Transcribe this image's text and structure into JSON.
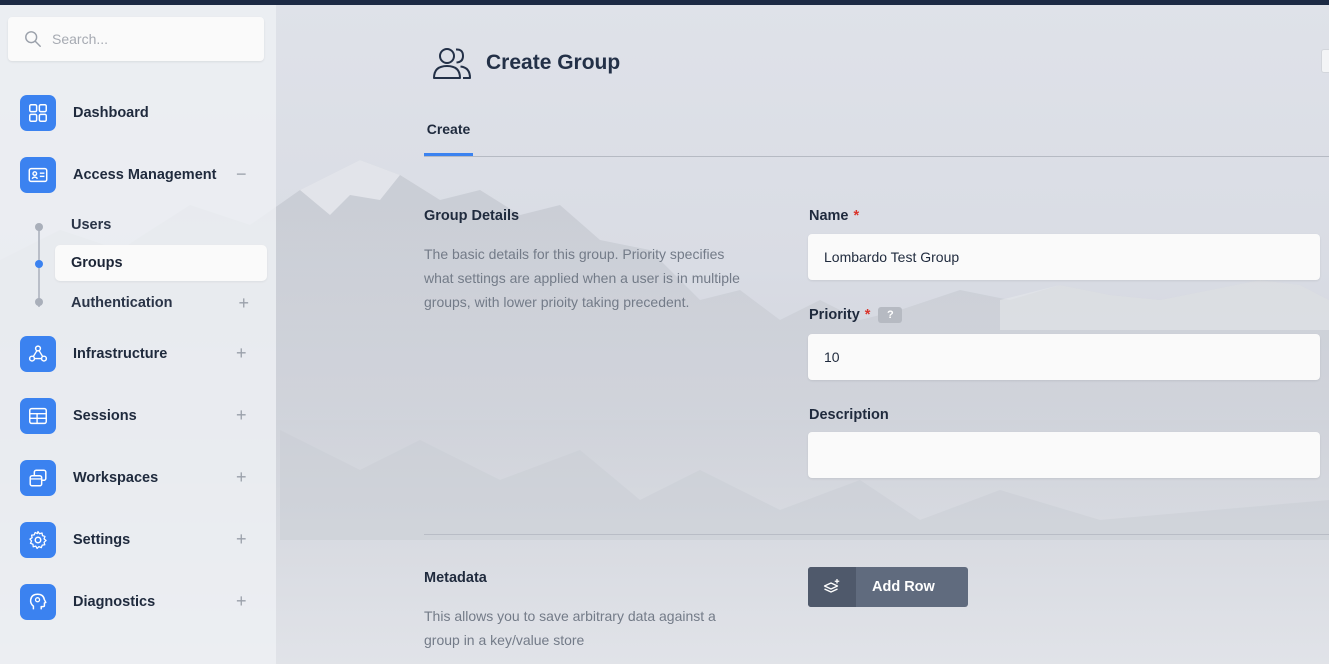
{
  "sidebar": {
    "search_placeholder": "Search...",
    "items": [
      {
        "label": "Dashboard",
        "icon": "dashboard-icon"
      },
      {
        "label": "Access Management",
        "icon": "id-card-icon",
        "toggle": "−"
      },
      {
        "label": "Infrastructure",
        "icon": "network-icon",
        "toggle": "+"
      },
      {
        "label": "Sessions",
        "icon": "table-icon",
        "toggle": "+"
      },
      {
        "label": "Workspaces",
        "icon": "workspaces-icon",
        "toggle": "+"
      },
      {
        "label": "Settings",
        "icon": "gear-icon",
        "toggle": "+"
      },
      {
        "label": "Diagnostics",
        "icon": "diagnostics-icon",
        "toggle": "+"
      }
    ],
    "sub_items": [
      {
        "label": "Users"
      },
      {
        "label": "Groups",
        "active": true
      },
      {
        "label": "Authentication",
        "toggle": "+"
      }
    ]
  },
  "header": {
    "title": "Create Group",
    "icon": "users-icon"
  },
  "tabs": [
    {
      "label": "Create",
      "active": true
    }
  ],
  "group_details": {
    "title": "Group Details",
    "description": "The basic details for this group. Priority specifies what settings are applied when a user is in multiple groups, with lower prioity taking precedent.",
    "name_label": "Name",
    "name_value": "Lombardo Test Group",
    "priority_label": "Priority",
    "priority_value": "10",
    "priority_help": "?",
    "description_label": "Description",
    "description_value": "",
    "required_mark": "*"
  },
  "metadata": {
    "title": "Metadata",
    "description": "This allows you to save arbitrary data against a group in a key/value store",
    "add_row_label": "Add Row"
  },
  "colors": {
    "accent": "#3b82f0",
    "required": "#d9342b",
    "topbar": "#1c2a44",
    "button": "#606b7e"
  }
}
